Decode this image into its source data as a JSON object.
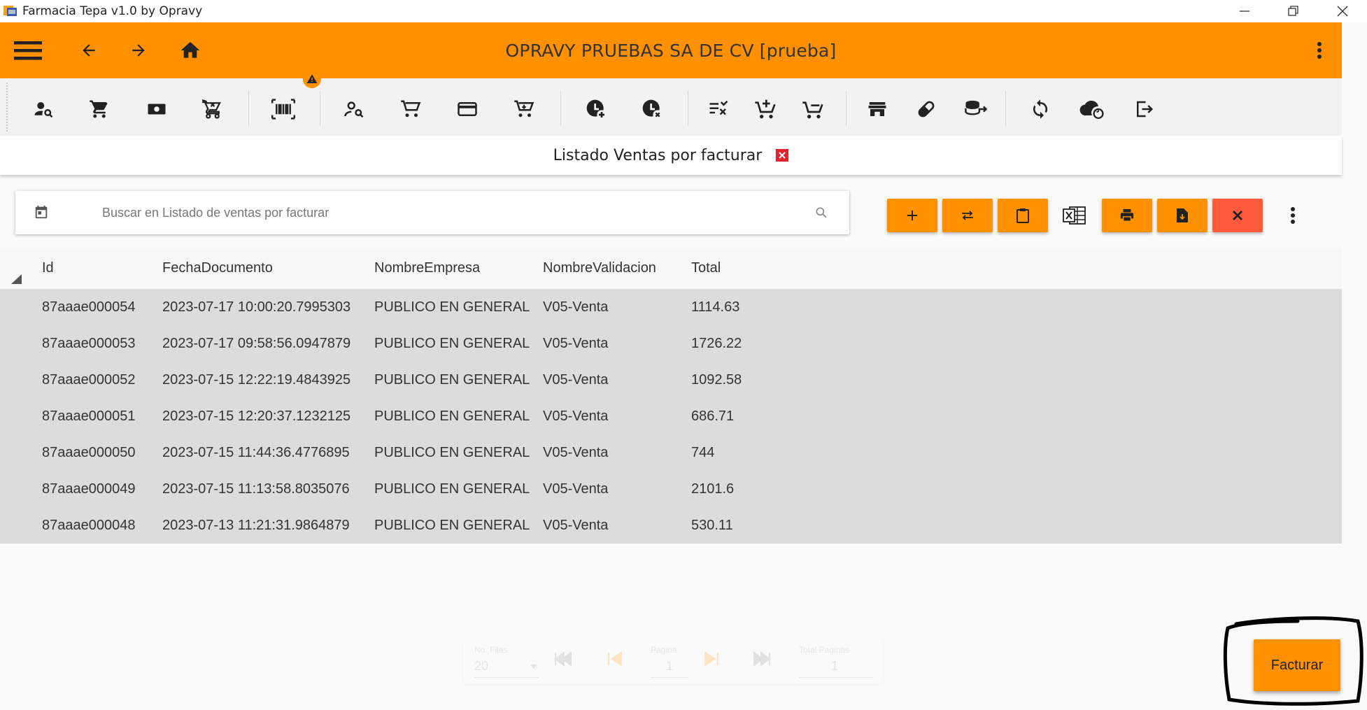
{
  "window": {
    "title": "Farmacia Tepa v1.0 by Opravy",
    "controls": [
      "minimize-icon",
      "restore-icon",
      "close-icon"
    ]
  },
  "appbar": {
    "company": "OPRAVY PRUEBAS SA DE CV [prueba]",
    "left_icons": [
      "menu-icon",
      "arrow-back-icon",
      "arrow-forward-icon",
      "home-icon"
    ],
    "right_icon": "more-vert-icon",
    "color": "#ff9100"
  },
  "toolbar": {
    "icons": [
      "person-search-icon",
      "shopping-cart-icon",
      "cash-icon",
      "cart-remove-icon",
      "barcode-icon",
      "person-search-outline-icon",
      "cart-outline-icon",
      "credit-card-icon",
      "cart-arrow-icon",
      "clock-plus-icon",
      "clock-remove-icon",
      "playlist-remove-icon",
      "cart-plus-icon",
      "cart-check-icon",
      "store-icon",
      "pill-icon",
      "database-arrow-icon",
      "sync-icon",
      "cloud-sync-icon",
      "logout-icon"
    ],
    "warning_badge": "warning-icon"
  },
  "page": {
    "title": "Listado Ventas por facturar",
    "close_color": "#e0232d"
  },
  "search": {
    "placeholder": "Buscar en Listado de ventas por facturar",
    "value": ""
  },
  "actions": [
    "add",
    "swap",
    "clipboard",
    "excel",
    "print",
    "file-download",
    "delete",
    "more"
  ],
  "table": {
    "columns": [
      "Id",
      "FechaDocumento",
      "NombreEmpresa",
      "NombreValidacion",
      "Total"
    ],
    "rows": [
      [
        "87aaae000054",
        "2023-07-17 10:00:20.7995303",
        "PUBLICO EN GENERAL",
        "V05-Venta",
        "1114.63"
      ],
      [
        "87aaae000053",
        "2023-07-17 09:58:56.0947879",
        "PUBLICO EN GENERAL",
        "V05-Venta",
        "1726.22"
      ],
      [
        "87aaae000052",
        "2023-07-15 12:22:19.4843925",
        "PUBLICO EN GENERAL",
        "V05-Venta",
        "1092.58"
      ],
      [
        "87aaae000051",
        "2023-07-15 12:20:37.1232125",
        "PUBLICO EN GENERAL",
        "V05-Venta",
        "686.71"
      ],
      [
        "87aaae000050",
        "2023-07-15 11:44:36.4776895",
        "PUBLICO EN GENERAL",
        "V05-Venta",
        "744"
      ],
      [
        "87aaae000049",
        "2023-07-15 11:13:58.8035076",
        "PUBLICO EN GENERAL",
        "V05-Venta",
        "2101.6"
      ],
      [
        "87aaae000048",
        "2023-07-13 11:21:31.9864879",
        "PUBLICO EN GENERAL",
        "V05-Venta",
        "530.11"
      ]
    ]
  },
  "pager": {
    "rows_label": "No. Filas",
    "rows_value": "20",
    "page_label": "Pagina",
    "page_value": "1",
    "total_label": "Total Paginas",
    "total_value": "1"
  },
  "facturar_label": "Facturar"
}
